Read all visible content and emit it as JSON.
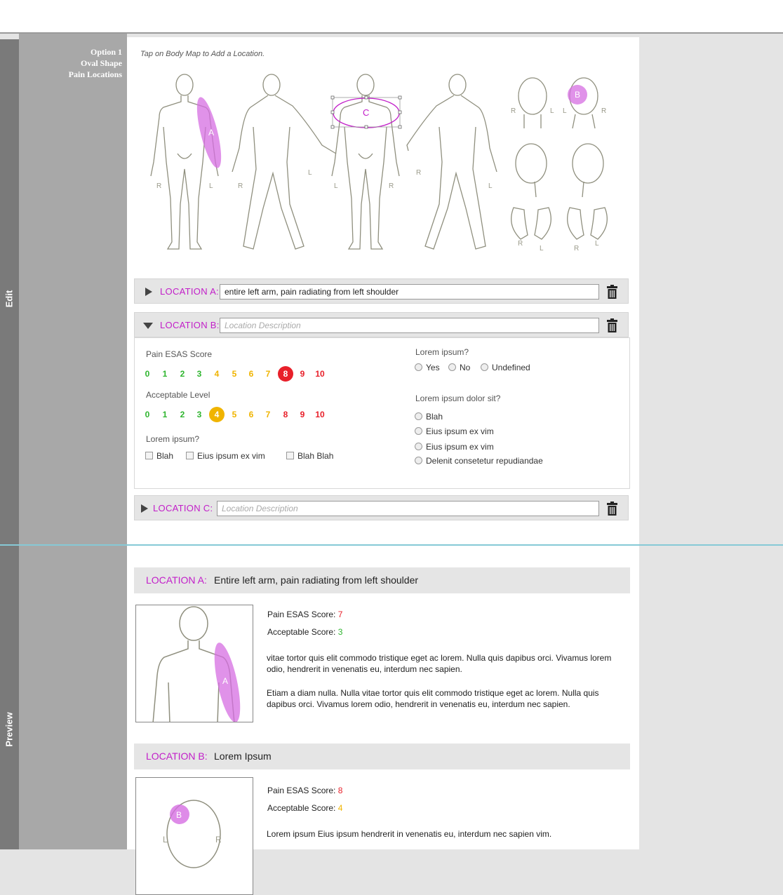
{
  "strips": {
    "edit_label": "Edit",
    "preview_label": "Preview"
  },
  "sidebar": {
    "line1": "Option 1",
    "line2": "Oval Shape",
    "line3": "Pain Locations"
  },
  "body_map": {
    "hint": "Tap on Body Map to Add a Location.",
    "markers": {
      "a": "A",
      "b": "B",
      "c": "C"
    },
    "side_letters": {
      "r": "R",
      "l": "L"
    },
    "marker_color": "#d66ee2"
  },
  "locations": {
    "a": {
      "label": "LOCATION A:",
      "value": "entire left arm, pain radiating from left shoulder",
      "placeholder": "Location Description"
    },
    "b": {
      "label": "LOCATION B:",
      "value": "",
      "placeholder": "Location Description"
    },
    "c": {
      "label": "LOCATION C:",
      "value": "",
      "placeholder": "Location Description"
    }
  },
  "detail": {
    "pain_label": "Pain ESAS Score",
    "acceptable_label": "Acceptable Level",
    "scale": [
      "0",
      "1",
      "2",
      "3",
      "4",
      "5",
      "6",
      "7",
      "8",
      "9",
      "10"
    ],
    "scale_colors": [
      "#2fb52f",
      "#2fb52f",
      "#2fb52f",
      "#2fb52f",
      "#f0b400",
      "#f0b400",
      "#f0b400",
      "#f0b400",
      "#e8202a",
      "#e8202a",
      "#e8202a"
    ],
    "pain_selected": 8,
    "acceptable_selected": 4,
    "checkbox_question": "Lorem ipsum?",
    "checkboxes": [
      "Blah",
      "Eius ipsum ex vim",
      "Blah Blah"
    ],
    "question1": "Lorem ipsum?",
    "radios1": [
      "Yes",
      "No",
      "Undefined"
    ],
    "question2": "Lorem ipsum dolor sit?",
    "radios2": [
      "Blah",
      "Eius ipsum ex vim",
      "Eius ipsum ex vim",
      "Delenit consetetur repudiandae"
    ]
  },
  "preview": {
    "a": {
      "label": "LOCATION A:",
      "title": "Entire left arm, pain radiating from left shoulder",
      "pain_label": "Pain ESAS Score:",
      "pain_value": "7",
      "acc_label": "Acceptable Score:",
      "acc_value": "3",
      "para1": "vitae tortor quis elit commodo tristique eget ac lorem. Nulla quis dapibus orci. Vivamus lorem odio, hendrerit in venenatis eu, interdum nec sapien.",
      "para2": "Etiam a diam nulla. Nulla vitae tortor quis elit commodo tristique eget ac lorem. Nulla quis dapibus orci. Vivamus lorem odio, hendrerit in venenatis eu, interdum nec sapien."
    },
    "b": {
      "label": "LOCATION B:",
      "title": "Lorem Ipsum",
      "pain_label": "Pain ESAS Score:",
      "pain_value": "8",
      "acc_label": "Acceptable Score:",
      "acc_value": "4",
      "para1": "Lorem ipsum Eius ipsum hendrerit in venenatis eu, interdum nec sapien vim."
    }
  },
  "colors": {
    "accent_magenta": "#c21ec9",
    "divider": "#86c9d6",
    "red": "#e8202a",
    "green": "#2fb52f",
    "yellow": "#f0b400"
  }
}
